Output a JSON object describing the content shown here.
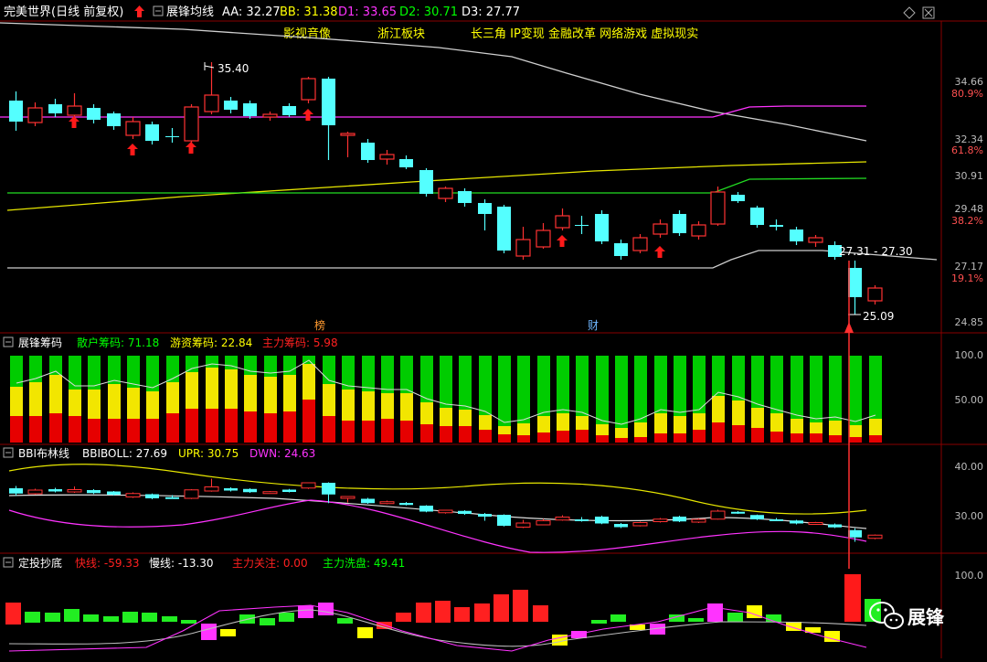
{
  "header": {
    "stock_name": "完美世界(日线 前复权)",
    "indicator_name": "展锋均线",
    "items": [
      {
        "label": "AA: 32.27",
        "color": "#ffffff"
      },
      {
        "label": "BB: 31.38",
        "color": "#ffff00"
      },
      {
        "label": "D1: 33.65",
        "color": "#ff33ff"
      },
      {
        "label": "D2: 30.71",
        "color": "#00ff00"
      },
      {
        "label": "D3: 27.77",
        "color": "#ffffff"
      }
    ],
    "concepts": [
      "影视音像",
      "浙江板块",
      "长三角 IP变现 金融改革 网络游戏 虚拟现实"
    ]
  },
  "main": {
    "price_axis": [
      "34.66",
      "32.34",
      "30.91",
      "29.48",
      "27.17",
      "24.85"
    ],
    "pct_axis": [
      "80.9%",
      "61.8%",
      "38.2%",
      "19.1%"
    ],
    "high_label": "35.40",
    "low_label": "25.09",
    "last_label": "27.31 - 27.30",
    "markers": [
      "榜",
      "财"
    ]
  },
  "chips": {
    "title": "展锋筹码",
    "retail": "散户筹码: 71.18",
    "hot": "游资筹码: 22.84",
    "main": "主力筹码: 5.98",
    "axis": [
      "100.0",
      "50.00"
    ]
  },
  "boll": {
    "title": "BBI布林线",
    "mid": "BBIBOLL: 27.69",
    "upr": "UPR: 30.75",
    "dwn": "DWN: 24.63",
    "axis": [
      "40.00",
      "30.00"
    ]
  },
  "dip": {
    "title": "定投抄底",
    "fast": "快线: -59.33",
    "slow": "慢线: -13.30",
    "focus": "主力关注: 0.00",
    "wash": "主力洗盘: 49.41",
    "axis": [
      "100.0"
    ]
  },
  "watermark": {
    "text": "展锋"
  },
  "colors": {
    "up": "#ff3232",
    "down": "#54ffff",
    "green": "#00ff00",
    "yellow": "#ffff00",
    "magenta": "#ff33ff"
  }
}
